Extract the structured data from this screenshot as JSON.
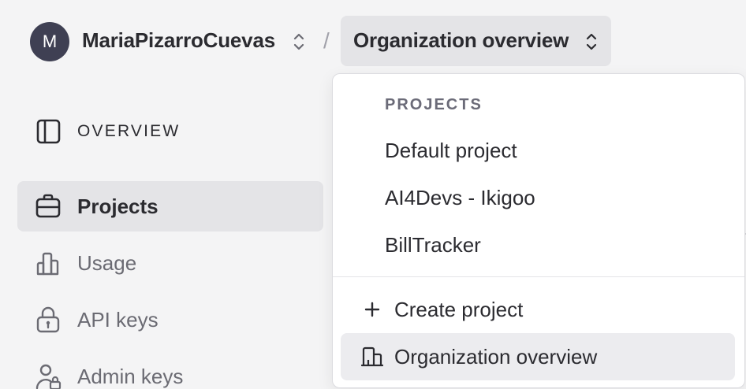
{
  "header": {
    "avatar_letter": "M",
    "org_name": "MariaPizarroCuevas",
    "separator": "/",
    "current_page": "Organization overview"
  },
  "sidebar": {
    "section_label": "OVERVIEW",
    "items": [
      {
        "label": "Projects",
        "icon": "briefcase-icon",
        "active": true
      },
      {
        "label": "Usage",
        "icon": "bar-chart-icon",
        "active": false
      },
      {
        "label": "API keys",
        "icon": "lock-icon",
        "active": false
      },
      {
        "label": "Admin keys",
        "icon": "user-lock-icon",
        "active": false
      }
    ]
  },
  "dropdown": {
    "heading": "PROJECTS",
    "projects": [
      "Default project",
      "AI4Devs - Ikigoo",
      "BillTracker"
    ],
    "actions": [
      {
        "label": "Create project",
        "icon": "plus-icon",
        "highlighted": false
      },
      {
        "label": "Organization overview",
        "icon": "building-icon",
        "highlighted": true
      }
    ]
  },
  "colors": {
    "background": "#f4f4f5",
    "active_bg": "#e4e4e7",
    "avatar_bg": "#3f4053",
    "text": "#2b2b30",
    "muted_text": "#6b6b73"
  }
}
